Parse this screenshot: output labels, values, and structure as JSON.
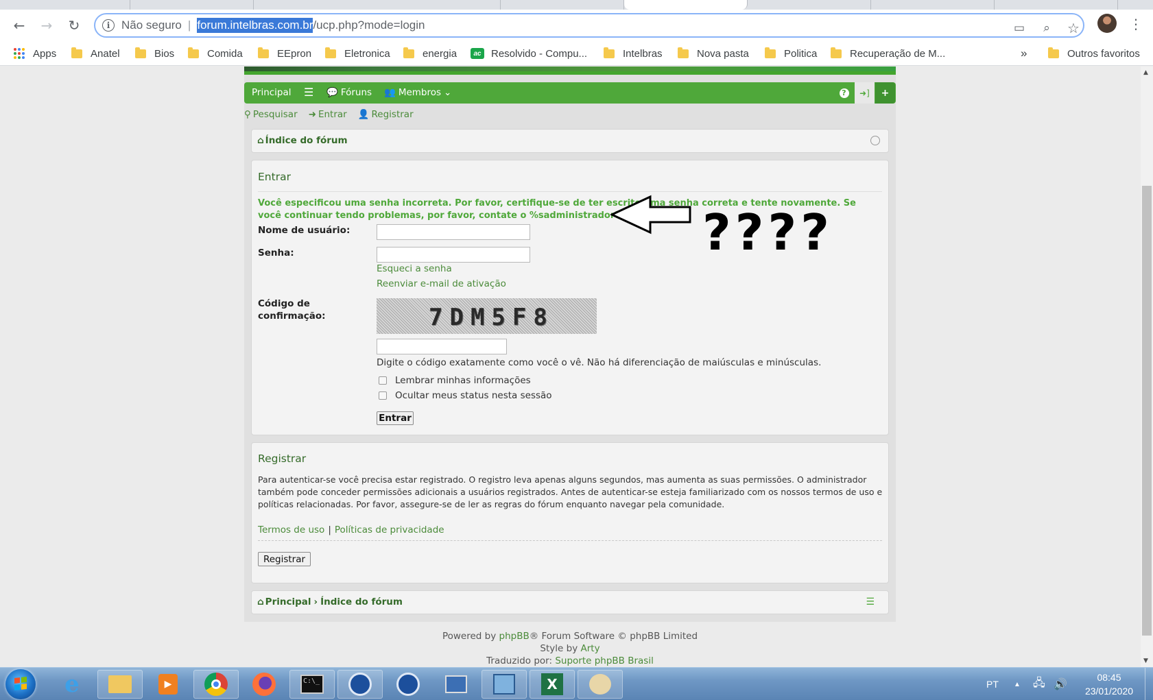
{
  "browser": {
    "back_icon": "←",
    "forward_icon": "→",
    "reload_icon": "↻",
    "security_label": "Não seguro",
    "separator": "|",
    "url_host": "forum.intelbras.com.br",
    "url_path": "/ucp.php?mode=login",
    "cast_icon": "▭",
    "zoom_icon": "⌕",
    "star_icon": "☆",
    "menu_icon": "⋮"
  },
  "bookmarks": {
    "items": [
      {
        "label": "Apps",
        "type": "apps"
      },
      {
        "label": "Anatel",
        "type": "folder"
      },
      {
        "label": "Bios",
        "type": "folder"
      },
      {
        "label": "Comida",
        "type": "folder"
      },
      {
        "label": "EEpron",
        "type": "folder"
      },
      {
        "label": "Eletronica",
        "type": "folder"
      },
      {
        "label": "energia",
        "type": "folder"
      },
      {
        "label": "Resolvido - Compu...",
        "type": "site",
        "icon_text": "ac"
      },
      {
        "label": "Intelbras",
        "type": "folder"
      },
      {
        "label": "Nova pasta",
        "type": "folder"
      },
      {
        "label": "Politica",
        "type": "folder"
      },
      {
        "label": "Recuperação de M...",
        "type": "folder"
      }
    ],
    "more": "»",
    "others": "Outros favoritos"
  },
  "forum": {
    "nav": {
      "home": "Principal",
      "forums": "Fóruns",
      "members": "Membros",
      "faq_icon": "?",
      "login_icon": "➜]",
      "register_icon": "+"
    },
    "subnav": {
      "search": "Pesquisar",
      "login": "Entrar",
      "register": "Registrar"
    },
    "index_crumb": "Índice do fórum",
    "login": {
      "title": "Entrar",
      "error": "Você especificou uma senha incorreta. Por favor, certifique-se de ter escrito uma senha correta e tente novamente. Se você continuar tendo problemas, por favor, contate o %sadministrador%s.",
      "username_label": "Nome de usuário:",
      "password_label": "Senha:",
      "forgot_link": "Esqueci a senha",
      "resend_link": "Reenviar e-mail de ativação",
      "captcha_label_1": "Código de",
      "captcha_label_2": "confirmação:",
      "captcha_text": "7DM5F8",
      "captcha_hint": "Digite o código exatamente como você o vê. Não há diferenciação de maiúsculas e minúsculas.",
      "remember": "Lembrar minhas informações",
      "hide_status": "Ocultar meus status nesta sessão",
      "submit": "Entrar"
    },
    "register": {
      "title": "Registrar",
      "text": "Para autenticar-se você precisa estar registrado. O registro leva apenas alguns segundos, mas aumenta as suas permissões. O administrador também pode conceder permissões adicionais a usuários registrados. Antes de autenticar-se esteja familiarizado com os nossos termos de uso e políticas relacionadas. Por favor, assegure-se de ler as regras do fórum enquanto navegar pela comunidade.",
      "terms": "Termos de uso",
      "sep": "|",
      "privacy": "Políticas de privacidade",
      "button": "Registrar"
    },
    "bottom_crumb": {
      "home": "Principal",
      "index": "Índice do fórum"
    },
    "footer": {
      "powered_pre": "Powered by ",
      "phpbb": "phpBB",
      "powered_post": "® Forum Software © phpBB Limited",
      "style_pre": "Style by ",
      "style_author": "Arty",
      "trans_pre": "Traduzido por: ",
      "trans_author": "Suporte phpBB Brasil"
    }
  },
  "annotation": {
    "question_marks": "????"
  },
  "taskbar": {
    "apps": [
      "internet-explorer",
      "file-explorer",
      "media-player",
      "chrome",
      "firefox",
      "command-prompt",
      "app-blue-1",
      "app-blue-2",
      "remote-desktop",
      "network-tool",
      "excel",
      "paint"
    ],
    "language": "PT",
    "time": "08:45",
    "date": "23/01/2020"
  }
}
